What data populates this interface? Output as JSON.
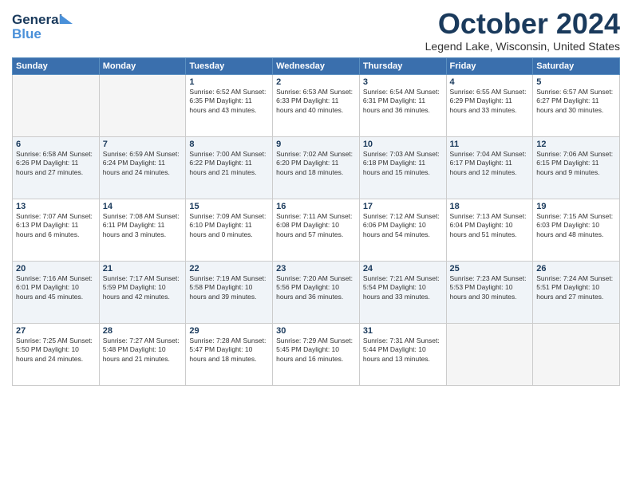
{
  "header": {
    "logo_line1": "General",
    "logo_line2": "Blue",
    "month": "October 2024",
    "location": "Legend Lake, Wisconsin, United States"
  },
  "weekdays": [
    "Sunday",
    "Monday",
    "Tuesday",
    "Wednesday",
    "Thursday",
    "Friday",
    "Saturday"
  ],
  "weeks": [
    [
      {
        "day": "",
        "info": ""
      },
      {
        "day": "",
        "info": ""
      },
      {
        "day": "1",
        "info": "Sunrise: 6:52 AM\nSunset: 6:35 PM\nDaylight: 11 hours and 43 minutes."
      },
      {
        "day": "2",
        "info": "Sunrise: 6:53 AM\nSunset: 6:33 PM\nDaylight: 11 hours and 40 minutes."
      },
      {
        "day": "3",
        "info": "Sunrise: 6:54 AM\nSunset: 6:31 PM\nDaylight: 11 hours and 36 minutes."
      },
      {
        "day": "4",
        "info": "Sunrise: 6:55 AM\nSunset: 6:29 PM\nDaylight: 11 hours and 33 minutes."
      },
      {
        "day": "5",
        "info": "Sunrise: 6:57 AM\nSunset: 6:27 PM\nDaylight: 11 hours and 30 minutes."
      }
    ],
    [
      {
        "day": "6",
        "info": "Sunrise: 6:58 AM\nSunset: 6:26 PM\nDaylight: 11 hours and 27 minutes."
      },
      {
        "day": "7",
        "info": "Sunrise: 6:59 AM\nSunset: 6:24 PM\nDaylight: 11 hours and 24 minutes."
      },
      {
        "day": "8",
        "info": "Sunrise: 7:00 AM\nSunset: 6:22 PM\nDaylight: 11 hours and 21 minutes."
      },
      {
        "day": "9",
        "info": "Sunrise: 7:02 AM\nSunset: 6:20 PM\nDaylight: 11 hours and 18 minutes."
      },
      {
        "day": "10",
        "info": "Sunrise: 7:03 AM\nSunset: 6:18 PM\nDaylight: 11 hours and 15 minutes."
      },
      {
        "day": "11",
        "info": "Sunrise: 7:04 AM\nSunset: 6:17 PM\nDaylight: 11 hours and 12 minutes."
      },
      {
        "day": "12",
        "info": "Sunrise: 7:06 AM\nSunset: 6:15 PM\nDaylight: 11 hours and 9 minutes."
      }
    ],
    [
      {
        "day": "13",
        "info": "Sunrise: 7:07 AM\nSunset: 6:13 PM\nDaylight: 11 hours and 6 minutes."
      },
      {
        "day": "14",
        "info": "Sunrise: 7:08 AM\nSunset: 6:11 PM\nDaylight: 11 hours and 3 minutes."
      },
      {
        "day": "15",
        "info": "Sunrise: 7:09 AM\nSunset: 6:10 PM\nDaylight: 11 hours and 0 minutes."
      },
      {
        "day": "16",
        "info": "Sunrise: 7:11 AM\nSunset: 6:08 PM\nDaylight: 10 hours and 57 minutes."
      },
      {
        "day": "17",
        "info": "Sunrise: 7:12 AM\nSunset: 6:06 PM\nDaylight: 10 hours and 54 minutes."
      },
      {
        "day": "18",
        "info": "Sunrise: 7:13 AM\nSunset: 6:04 PM\nDaylight: 10 hours and 51 minutes."
      },
      {
        "day": "19",
        "info": "Sunrise: 7:15 AM\nSunset: 6:03 PM\nDaylight: 10 hours and 48 minutes."
      }
    ],
    [
      {
        "day": "20",
        "info": "Sunrise: 7:16 AM\nSunset: 6:01 PM\nDaylight: 10 hours and 45 minutes."
      },
      {
        "day": "21",
        "info": "Sunrise: 7:17 AM\nSunset: 5:59 PM\nDaylight: 10 hours and 42 minutes."
      },
      {
        "day": "22",
        "info": "Sunrise: 7:19 AM\nSunset: 5:58 PM\nDaylight: 10 hours and 39 minutes."
      },
      {
        "day": "23",
        "info": "Sunrise: 7:20 AM\nSunset: 5:56 PM\nDaylight: 10 hours and 36 minutes."
      },
      {
        "day": "24",
        "info": "Sunrise: 7:21 AM\nSunset: 5:54 PM\nDaylight: 10 hours and 33 minutes."
      },
      {
        "day": "25",
        "info": "Sunrise: 7:23 AM\nSunset: 5:53 PM\nDaylight: 10 hours and 30 minutes."
      },
      {
        "day": "26",
        "info": "Sunrise: 7:24 AM\nSunset: 5:51 PM\nDaylight: 10 hours and 27 minutes."
      }
    ],
    [
      {
        "day": "27",
        "info": "Sunrise: 7:25 AM\nSunset: 5:50 PM\nDaylight: 10 hours and 24 minutes."
      },
      {
        "day": "28",
        "info": "Sunrise: 7:27 AM\nSunset: 5:48 PM\nDaylight: 10 hours and 21 minutes."
      },
      {
        "day": "29",
        "info": "Sunrise: 7:28 AM\nSunset: 5:47 PM\nDaylight: 10 hours and 18 minutes."
      },
      {
        "day": "30",
        "info": "Sunrise: 7:29 AM\nSunset: 5:45 PM\nDaylight: 10 hours and 16 minutes."
      },
      {
        "day": "31",
        "info": "Sunrise: 7:31 AM\nSunset: 5:44 PM\nDaylight: 10 hours and 13 minutes."
      },
      {
        "day": "",
        "info": ""
      },
      {
        "day": "",
        "info": ""
      }
    ]
  ]
}
